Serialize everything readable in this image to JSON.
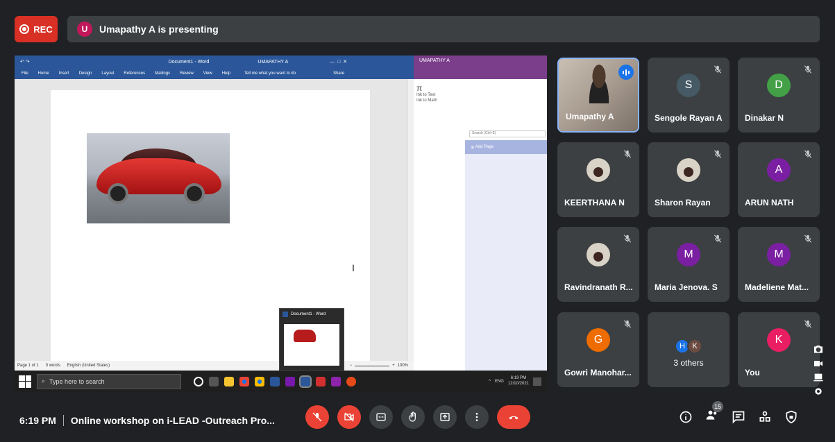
{
  "top_bar": {
    "rec_label": "REC",
    "presenter_initial": "U",
    "presenting_text": "Umapathy A is presenting"
  },
  "shared_screen": {
    "word_title": "Document1 - Word",
    "word_user": "UMAPATHY A",
    "word_tabs": [
      "File",
      "Home",
      "Insert",
      "Design",
      "Layout",
      "References",
      "Mailings",
      "Review",
      "View",
      "Help"
    ],
    "tell_me": "Tell me what you want to do",
    "share_label": "Share",
    "status_page": "Page 1 of 1",
    "status_words": "0 words",
    "status_lang": "English (United States)",
    "zoom_level": "100%",
    "onenote_user": "UMAPATHY A",
    "ink_to_text": "Ink to Text",
    "ink_to_math": "Ink to Math",
    "search_placeholder": "Search (Ctrl+E)",
    "add_page": "Add Page",
    "taskbar_search": "Type here to search",
    "tray_lang": "ENG",
    "tray_time": "6:19 PM",
    "tray_date": "12/10/2021",
    "thumb_title": "Document1 - Word"
  },
  "participants": [
    {
      "name": "Umapathy A",
      "type": "video",
      "speaking": true
    },
    {
      "name": "Sengole Rayan A",
      "initial": "S",
      "color": "#455a64",
      "muted": true
    },
    {
      "name": "Dinakar N",
      "initial": "D",
      "color": "#43a047",
      "muted": true
    },
    {
      "name": "KEERTHANA N",
      "type": "photo",
      "muted": true
    },
    {
      "name": "Sharon Rayan",
      "type": "photo",
      "muted": true
    },
    {
      "name": "ARUN NATH",
      "initial": "A",
      "color": "#7b1fa2",
      "muted": true
    },
    {
      "name": "Ravindranath R...",
      "type": "photo",
      "muted": true
    },
    {
      "name": "Maria Jenova. S",
      "initial": "M",
      "color": "#7b1fa2",
      "muted": true
    },
    {
      "name": "Madeliene Mat...",
      "initial": "M",
      "color": "#7b1fa2",
      "muted": true
    },
    {
      "name": "Gowri Manohar...",
      "initial": "G",
      "color": "#ef6c00",
      "muted": true
    },
    {
      "name": "3 others",
      "others": [
        "H",
        "K"
      ],
      "other_colors": [
        "#1a73e8",
        "#6d4c41"
      ]
    },
    {
      "name": "You",
      "initial": "K",
      "color": "#e91e63",
      "muted": true
    }
  ],
  "bottom_bar": {
    "time": "6:19 PM",
    "meeting_title": "Online workshop on i-LEAD -Outreach Pro...",
    "people_count": "15"
  },
  "colors": {
    "background": "#202124",
    "tile": "#3c4043",
    "danger": "#ea4335",
    "accent": "#8ab4f8"
  }
}
